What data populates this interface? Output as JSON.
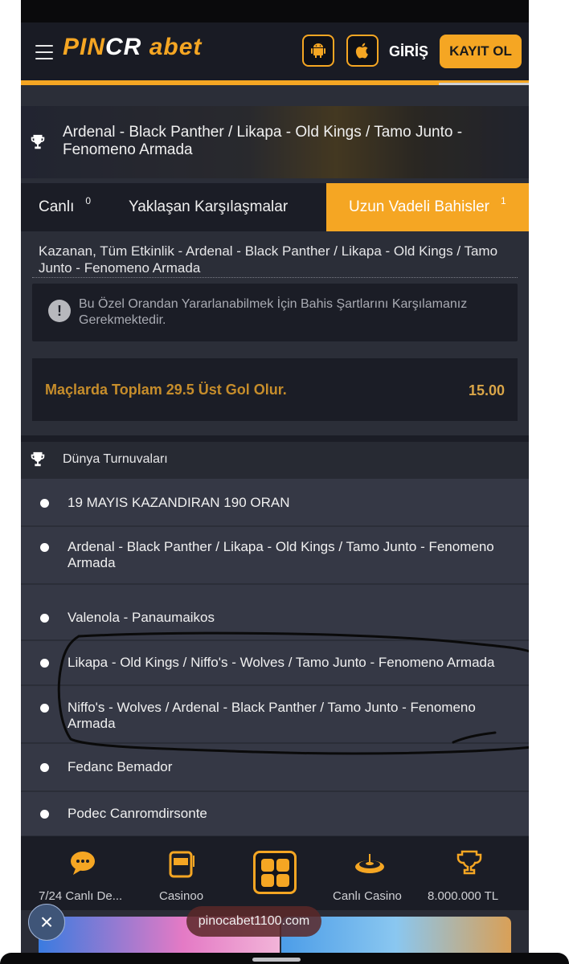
{
  "header": {
    "logo_left": "PIN",
    "logo_mid": "CR",
    "logo_right": "abet",
    "login_label": "GİRİŞ",
    "register_label": "KAYIT OL"
  },
  "banner": {
    "title": "Ardenal - Black Panther / Likapa - Old Kings / Tamo Junto - Fenomeno Armada"
  },
  "tabs": [
    {
      "label": "Canlı",
      "count": "0"
    },
    {
      "label": "Yaklaşan Karşılaşmalar",
      "count": ""
    },
    {
      "label": "Uzun Vadeli Bahisler",
      "count": "1"
    }
  ],
  "market": {
    "title": "Kazanan, Tüm Etkinlik - Ardenal - Black Panther / Likapa - Old Kings / Tamo Junto - Fenomeno Armada",
    "notice": "Bu Özel Orandan Yararlanabilmek İçin Bahis Şartlarını Karşılamanız Gerekmektedir.",
    "selection": "Maçlarda Toplam 29.5 Üst Gol Olur.",
    "odd": "15.00"
  },
  "section": {
    "title": "Dünya Turnuvaları",
    "items": [
      "19 MAYIS KAZANDIRAN 190 ORAN",
      "Ardenal - Black Panther / Likapa - Old Kings / Tamo Junto - Fenomeno Armada",
      "Valenola - Panaumaikos",
      "Likapa - Old Kings / Niffo's - Wolves / Tamo Junto - Fenomeno Armada",
      "Niffo's - Wolves / Ardenal - Black Panther / Tamo Junto - Fenomeno Armada",
      "Fedanc Bemador",
      "Podec Canromdirsonte"
    ]
  },
  "bottom_nav": [
    {
      "label": "7/24 Canlı De...",
      "icon": "chat-icon"
    },
    {
      "label": "Casinoo",
      "icon": "slot-machine-icon"
    },
    {
      "label": "",
      "icon": "grid-menu-icon"
    },
    {
      "label": "Canlı Casino",
      "icon": "roulette-icon"
    },
    {
      "label": "8.000.000 TL",
      "icon": "trophy-icon"
    }
  ],
  "overlay": {
    "url": "pinocabet1100.com"
  },
  "colors": {
    "accent": "#f5a623",
    "background": "#2b2e38",
    "panel": "#1b1d26"
  }
}
